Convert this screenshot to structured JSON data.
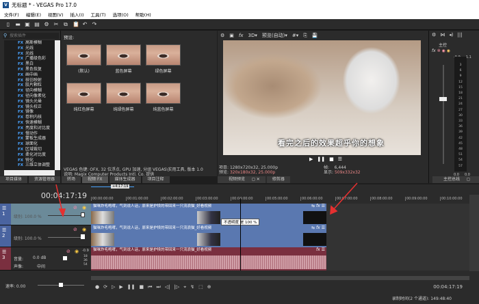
{
  "window": {
    "title": "无标题 * - VEGAS Pro 17.0",
    "logo": "V"
  },
  "menu": [
    "文件(F)",
    "编辑(E)",
    "视图(V)",
    "插入(I)",
    "工具(T)",
    "选项(O)",
    "帮助(H)"
  ],
  "toolbar_icons": [
    "new-icon",
    "open-icon",
    "save-icon",
    "properties-icon",
    "settings-icon",
    "cut-icon",
    "copy-icon",
    "paste-icon",
    "undo-icon",
    "redo-icon"
  ],
  "fx_panel": {
    "search_placeholder": "搜索插件",
    "items": [
      "高斯模糊",
      "光线",
      "光线",
      "广播级色彩",
      "黑白",
      "黑色恢复",
      "画中画",
      "核彷映射",
      "胶片颗粒",
      "径向模糊",
      "径向像素化",
      "镜头光晕",
      "镜头校正",
      "镜像",
      "卷积内核",
      "快速模糊",
      "亮度和对比度",
      "慢动作",
      "蒙板生成器",
      "球面化",
      "区域裁切",
      "柔化对比度",
      "锐化",
      "三维立体调整"
    ],
    "fx_badge": "FX"
  },
  "presets": {
    "label": "预设:",
    "items": [
      "(默认)",
      "蓝色屏幕",
      "绿色屏幕",
      "纯红色屏幕",
      "纯绿色屏幕",
      "纯蓝色屏幕"
    ],
    "info1": "VEGAS 色键: OFX, 32 位浮点, GPU 加速, 分组 VEGAS\\实用工具, 版本 1.0",
    "info2": "说明: Magix Computer Products Intl. Co. 提供"
  },
  "left_tabs": [
    "项目媒体",
    "资源管理器",
    "转场",
    "视频 FX",
    "媒体生成器",
    "项目注释"
  ],
  "preview": {
    "quality": "预览(自动)",
    "subtitle": "看完之后的效果超乎你的想象",
    "project_label": "项目:",
    "project": "1280x720x32, 25.000p",
    "preview_label": "预览:",
    "preview_val": "320x180x32, 25.000p",
    "frame_label": "帧:",
    "frame": "6,444",
    "display_label": "显示:",
    "display": "509x332x32",
    "tabs": [
      "视频预览",
      "修剪器"
    ]
  },
  "mixer": {
    "master": "主控",
    "peak_l": "-0.9",
    "peak_r": "-1.1",
    "ticks": [
      "3",
      "6",
      "9",
      "12",
      "15",
      "18",
      "21",
      "24",
      "27",
      "30",
      "33",
      "36",
      "39",
      "42",
      "45",
      "48",
      "51",
      "54",
      "57"
    ],
    "level_l": "0.0",
    "level_r": "0.0",
    "tab": "主控总线"
  },
  "timeline": {
    "timecode": "00:04:17:19",
    "loop_label": "+4:17:19",
    "ruler": [
      "00:00:00:00",
      "00:01:00:00",
      "00:02:00:00",
      "00:03:00:00",
      "00:04:00:00",
      "00:05:00:00",
      "00:06:00:00",
      "00:07:00:00",
      "00:08:00:00",
      "00:09:00:00",
      "00:10:00:00"
    ],
    "tracks": [
      {
        "num": "1",
        "level": "级别: 100.0 %"
      },
      {
        "num": "2",
        "level": "级别: 100.0 %"
      },
      {
        "num": "3",
        "volume_label": "音量:",
        "volume": "0.0 dB",
        "pan_label": "声像:",
        "pan": "中间",
        "peak": "-0.9",
        "ticks": [
          "18",
          "36",
          "54"
        ]
      }
    ],
    "clip_title": "猫咪炸毛咆哮，气到说人话，原来是护犊的带回来一只流浪猫_好看视频",
    "tooltip": "不透明度 是 100 %",
    "rate": "速率: 0.00",
    "end_time": "00:04:17:19"
  },
  "status": {
    "record": "录制时间(2 个通道): 149:48:40"
  },
  "colors": {
    "video_track": "#5a78b0",
    "audio_track": "#7a2f3f",
    "selected_header": "#6b8a99",
    "arrow": "#e53030"
  }
}
